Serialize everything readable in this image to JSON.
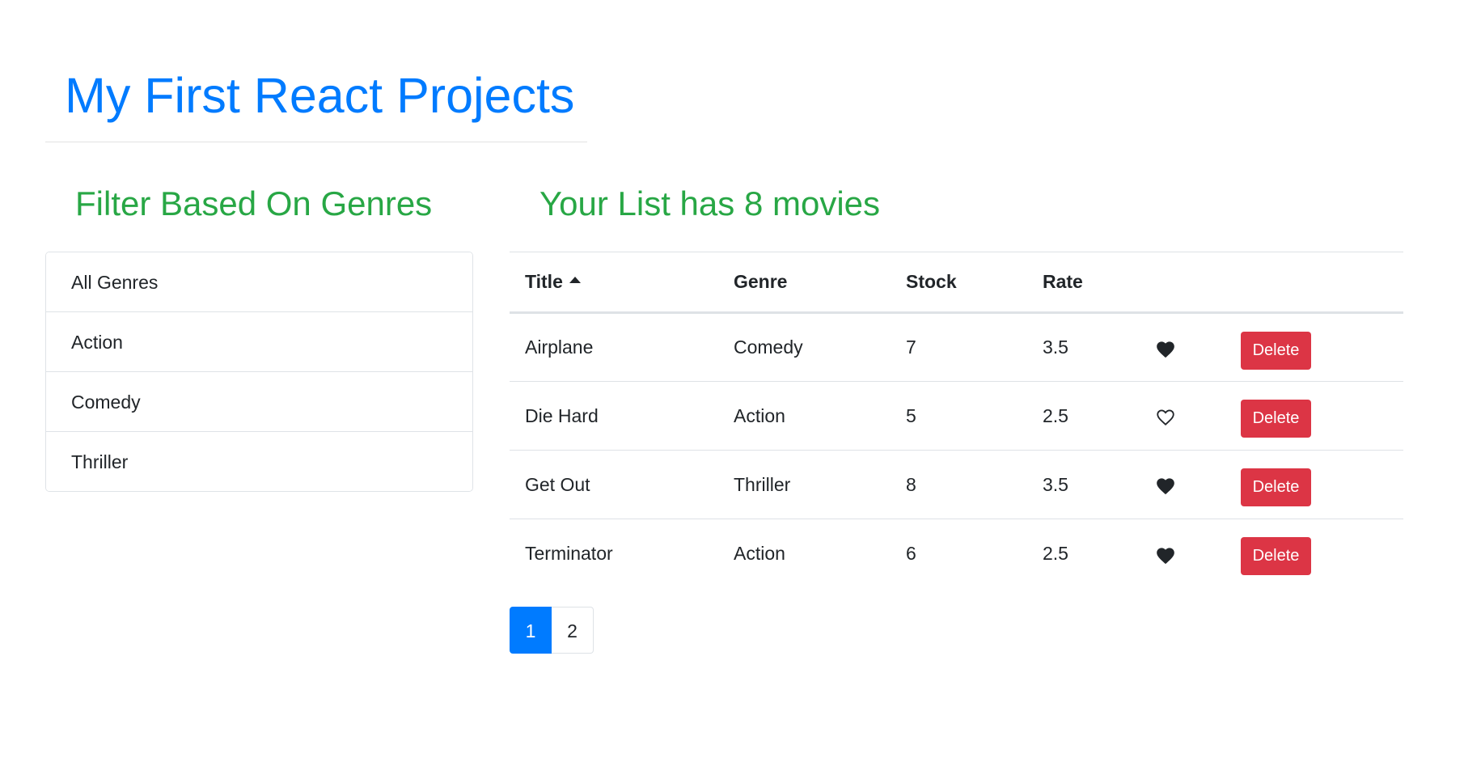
{
  "header": {
    "title": "My First React Projects"
  },
  "filter": {
    "heading": "Filter Based On Genres",
    "genres": [
      {
        "label": "All Genres"
      },
      {
        "label": "Action"
      },
      {
        "label": "Comedy"
      },
      {
        "label": "Thriller"
      }
    ]
  },
  "movies": {
    "heading": "Your List has 8 movies",
    "columns": {
      "title": "Title",
      "genre": "Genre",
      "stock": "Stock",
      "rate": "Rate"
    },
    "sort_icon": "caret-up-icon",
    "delete_label": "Delete",
    "rows": [
      {
        "title": "Airplane",
        "genre": "Comedy",
        "stock": "7",
        "rate": "3.5",
        "liked": true
      },
      {
        "title": "Die Hard",
        "genre": "Action",
        "stock": "5",
        "rate": "2.5",
        "liked": false
      },
      {
        "title": "Get Out",
        "genre": "Thriller",
        "stock": "8",
        "rate": "3.5",
        "liked": true
      },
      {
        "title": "Terminator",
        "genre": "Action",
        "stock": "6",
        "rate": "2.5",
        "liked": true
      }
    ]
  },
  "pagination": {
    "pages": [
      {
        "label": "1",
        "active": true
      },
      {
        "label": "2",
        "active": false
      }
    ]
  },
  "colors": {
    "title": "#007bff",
    "headings": "#28a745",
    "danger": "#dc3545",
    "active_page": "#007bff"
  }
}
